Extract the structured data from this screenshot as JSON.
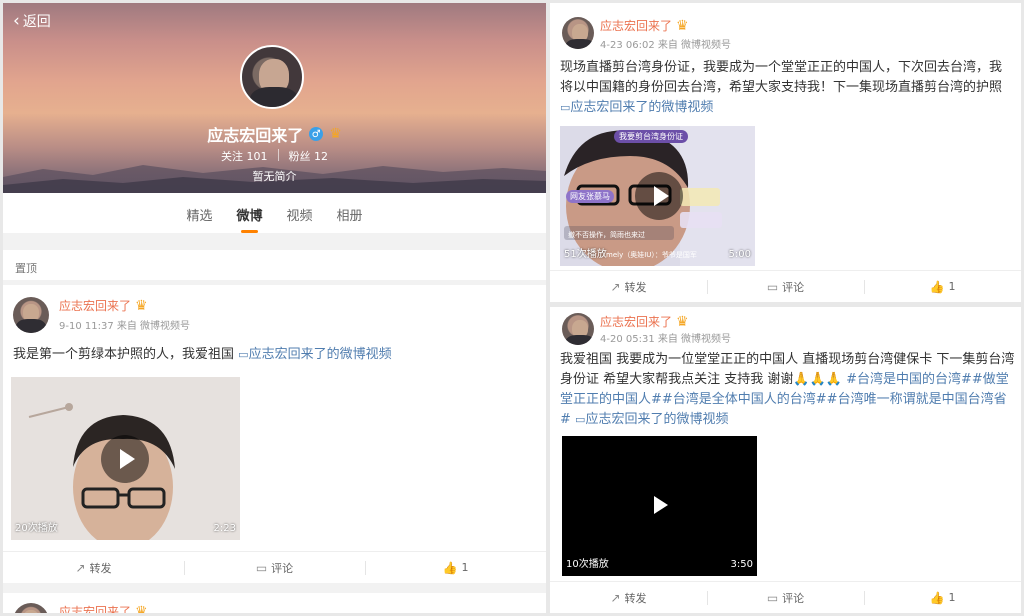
{
  "profile": {
    "back_label": "返回",
    "name": "应志宏回来了",
    "following_label": "关注",
    "following_count": "101",
    "followers_label": "粉丝",
    "followers_count": "12",
    "bio": "暂无简介",
    "icons": {
      "gender": "male-icon",
      "badge": "crown-badge-icon",
      "back": "chevron-left-icon"
    }
  },
  "tabs": [
    "精选",
    "微博",
    "视频",
    "相册"
  ],
  "active_tab": "微博",
  "pinned_label": "置顶",
  "video_link_label": "应志宏回来了的微博视频",
  "actions": {
    "repost": "转发",
    "comment": "评论",
    "like_count": "1"
  },
  "colors": {
    "name": "#eb7350",
    "link": "#507daf",
    "active_tab_underline": "#ff8200"
  },
  "posts": [
    {
      "author": "应志宏回来了",
      "meta": "9-10 11:37 来自 微博视频号",
      "text": "我是第一个剪绿本护照的人，我爱祖国",
      "video": {
        "plays": "20次播放",
        "duration": "2:23"
      }
    },
    {
      "author": "应志宏回来了"
    },
    {
      "author": "应志宏回来了",
      "meta": "4-23 06:02 来自 微博视频号",
      "text": "现场直播剪台湾身份证，我要成为一个堂堂正正的中国人，下次回去台湾，我将以中国籍的身份回去台湾，希望大家支持我！下一集现场直播剪台湾的护照",
      "video": {
        "plays": "51次播放",
        "duration": "5:00",
        "overlay_tag": "我要剪台湾身份证",
        "overlay_chip": "网友张慕马",
        "overlay_line1": "撤不否操作，简雨也来过",
        "overlay_line2": "mely（奥娃IU）：爷爷是国军"
      }
    },
    {
      "author": "应志宏回来了",
      "meta": "4-20 05:31 来自 微博视频号",
      "text": "我爱祖国 我要成为一位堂堂正正的中国人 直播现场剪台湾健保卡 下一集剪台湾身份证 希望大家帮我点关注 支持我 谢谢🙏🙏🙏",
      "hashtags": "#台湾是中国的台湾##做堂堂正正的中国人##台湾是全体中国人的台湾##台湾唯一称谓就是中国台湾省#",
      "video": {
        "plays": "10次播放",
        "duration": "3:50"
      }
    }
  ]
}
